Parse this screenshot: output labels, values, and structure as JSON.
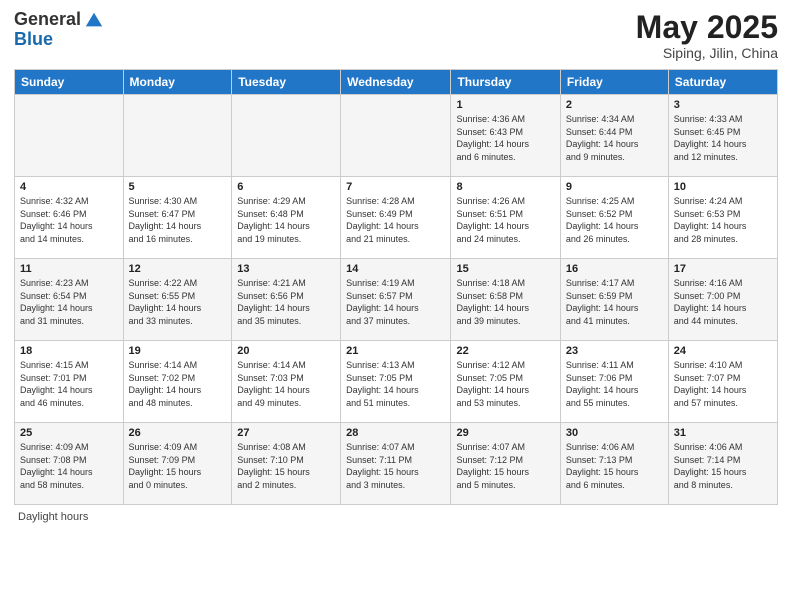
{
  "header": {
    "logo_general": "General",
    "logo_blue": "Blue",
    "month_title": "May 2025",
    "location": "Siping, Jilin, China"
  },
  "weekdays": [
    "Sunday",
    "Monday",
    "Tuesday",
    "Wednesday",
    "Thursday",
    "Friday",
    "Saturday"
  ],
  "weeks": [
    [
      {
        "day": "",
        "info": ""
      },
      {
        "day": "",
        "info": ""
      },
      {
        "day": "",
        "info": ""
      },
      {
        "day": "",
        "info": ""
      },
      {
        "day": "1",
        "info": "Sunrise: 4:36 AM\nSunset: 6:43 PM\nDaylight: 14 hours\nand 6 minutes."
      },
      {
        "day": "2",
        "info": "Sunrise: 4:34 AM\nSunset: 6:44 PM\nDaylight: 14 hours\nand 9 minutes."
      },
      {
        "day": "3",
        "info": "Sunrise: 4:33 AM\nSunset: 6:45 PM\nDaylight: 14 hours\nand 12 minutes."
      }
    ],
    [
      {
        "day": "4",
        "info": "Sunrise: 4:32 AM\nSunset: 6:46 PM\nDaylight: 14 hours\nand 14 minutes."
      },
      {
        "day": "5",
        "info": "Sunrise: 4:30 AM\nSunset: 6:47 PM\nDaylight: 14 hours\nand 16 minutes."
      },
      {
        "day": "6",
        "info": "Sunrise: 4:29 AM\nSunset: 6:48 PM\nDaylight: 14 hours\nand 19 minutes."
      },
      {
        "day": "7",
        "info": "Sunrise: 4:28 AM\nSunset: 6:49 PM\nDaylight: 14 hours\nand 21 minutes."
      },
      {
        "day": "8",
        "info": "Sunrise: 4:26 AM\nSunset: 6:51 PM\nDaylight: 14 hours\nand 24 minutes."
      },
      {
        "day": "9",
        "info": "Sunrise: 4:25 AM\nSunset: 6:52 PM\nDaylight: 14 hours\nand 26 minutes."
      },
      {
        "day": "10",
        "info": "Sunrise: 4:24 AM\nSunset: 6:53 PM\nDaylight: 14 hours\nand 28 minutes."
      }
    ],
    [
      {
        "day": "11",
        "info": "Sunrise: 4:23 AM\nSunset: 6:54 PM\nDaylight: 14 hours\nand 31 minutes."
      },
      {
        "day": "12",
        "info": "Sunrise: 4:22 AM\nSunset: 6:55 PM\nDaylight: 14 hours\nand 33 minutes."
      },
      {
        "day": "13",
        "info": "Sunrise: 4:21 AM\nSunset: 6:56 PM\nDaylight: 14 hours\nand 35 minutes."
      },
      {
        "day": "14",
        "info": "Sunrise: 4:19 AM\nSunset: 6:57 PM\nDaylight: 14 hours\nand 37 minutes."
      },
      {
        "day": "15",
        "info": "Sunrise: 4:18 AM\nSunset: 6:58 PM\nDaylight: 14 hours\nand 39 minutes."
      },
      {
        "day": "16",
        "info": "Sunrise: 4:17 AM\nSunset: 6:59 PM\nDaylight: 14 hours\nand 41 minutes."
      },
      {
        "day": "17",
        "info": "Sunrise: 4:16 AM\nSunset: 7:00 PM\nDaylight: 14 hours\nand 44 minutes."
      }
    ],
    [
      {
        "day": "18",
        "info": "Sunrise: 4:15 AM\nSunset: 7:01 PM\nDaylight: 14 hours\nand 46 minutes."
      },
      {
        "day": "19",
        "info": "Sunrise: 4:14 AM\nSunset: 7:02 PM\nDaylight: 14 hours\nand 48 minutes."
      },
      {
        "day": "20",
        "info": "Sunrise: 4:14 AM\nSunset: 7:03 PM\nDaylight: 14 hours\nand 49 minutes."
      },
      {
        "day": "21",
        "info": "Sunrise: 4:13 AM\nSunset: 7:05 PM\nDaylight: 14 hours\nand 51 minutes."
      },
      {
        "day": "22",
        "info": "Sunrise: 4:12 AM\nSunset: 7:05 PM\nDaylight: 14 hours\nand 53 minutes."
      },
      {
        "day": "23",
        "info": "Sunrise: 4:11 AM\nSunset: 7:06 PM\nDaylight: 14 hours\nand 55 minutes."
      },
      {
        "day": "24",
        "info": "Sunrise: 4:10 AM\nSunset: 7:07 PM\nDaylight: 14 hours\nand 57 minutes."
      }
    ],
    [
      {
        "day": "25",
        "info": "Sunrise: 4:09 AM\nSunset: 7:08 PM\nDaylight: 14 hours\nand 58 minutes."
      },
      {
        "day": "26",
        "info": "Sunrise: 4:09 AM\nSunset: 7:09 PM\nDaylight: 15 hours\nand 0 minutes."
      },
      {
        "day": "27",
        "info": "Sunrise: 4:08 AM\nSunset: 7:10 PM\nDaylight: 15 hours\nand 2 minutes."
      },
      {
        "day": "28",
        "info": "Sunrise: 4:07 AM\nSunset: 7:11 PM\nDaylight: 15 hours\nand 3 minutes."
      },
      {
        "day": "29",
        "info": "Sunrise: 4:07 AM\nSunset: 7:12 PM\nDaylight: 15 hours\nand 5 minutes."
      },
      {
        "day": "30",
        "info": "Sunrise: 4:06 AM\nSunset: 7:13 PM\nDaylight: 15 hours\nand 6 minutes."
      },
      {
        "day": "31",
        "info": "Sunrise: 4:06 AM\nSunset: 7:14 PM\nDaylight: 15 hours\nand 8 minutes."
      }
    ]
  ],
  "footer": {
    "daylight_label": "Daylight hours"
  }
}
